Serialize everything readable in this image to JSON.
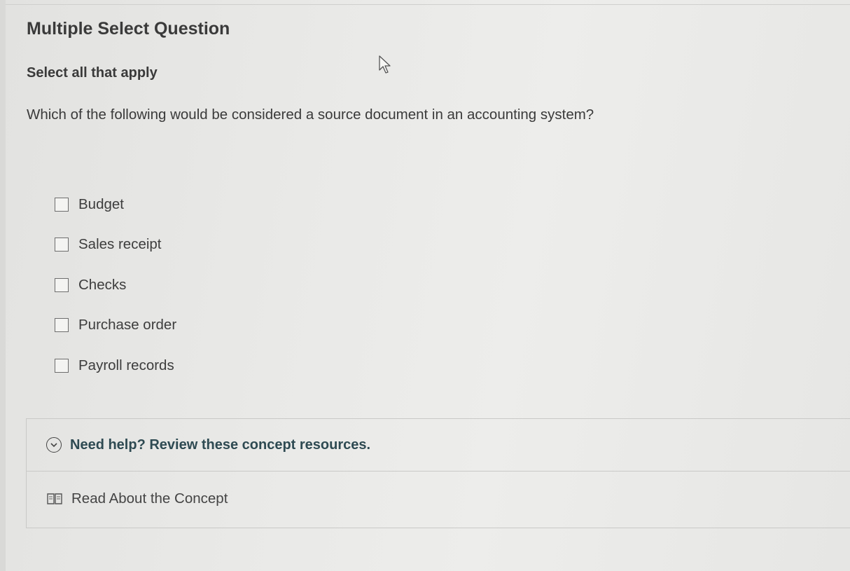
{
  "question": {
    "type_label": "Multiple Select Question",
    "instruction": "Select all that apply",
    "prompt": "Which of the following would be considered a source document in an accounting system?"
  },
  "options": [
    {
      "label": "Budget",
      "checked": false
    },
    {
      "label": "Sales receipt",
      "checked": false
    },
    {
      "label": "Checks",
      "checked": false
    },
    {
      "label": "Purchase order",
      "checked": false
    },
    {
      "label": "Payroll records",
      "checked": false
    }
  ],
  "help": {
    "toggle_label": "Need help? Review these concept resources.",
    "toggle_icon": "chevron-down-circle-icon",
    "resource_label": "Read About the Concept",
    "resource_icon": "book-icon"
  },
  "colors": {
    "help_title": "#2e4a52",
    "text": "#3a3a3a"
  }
}
